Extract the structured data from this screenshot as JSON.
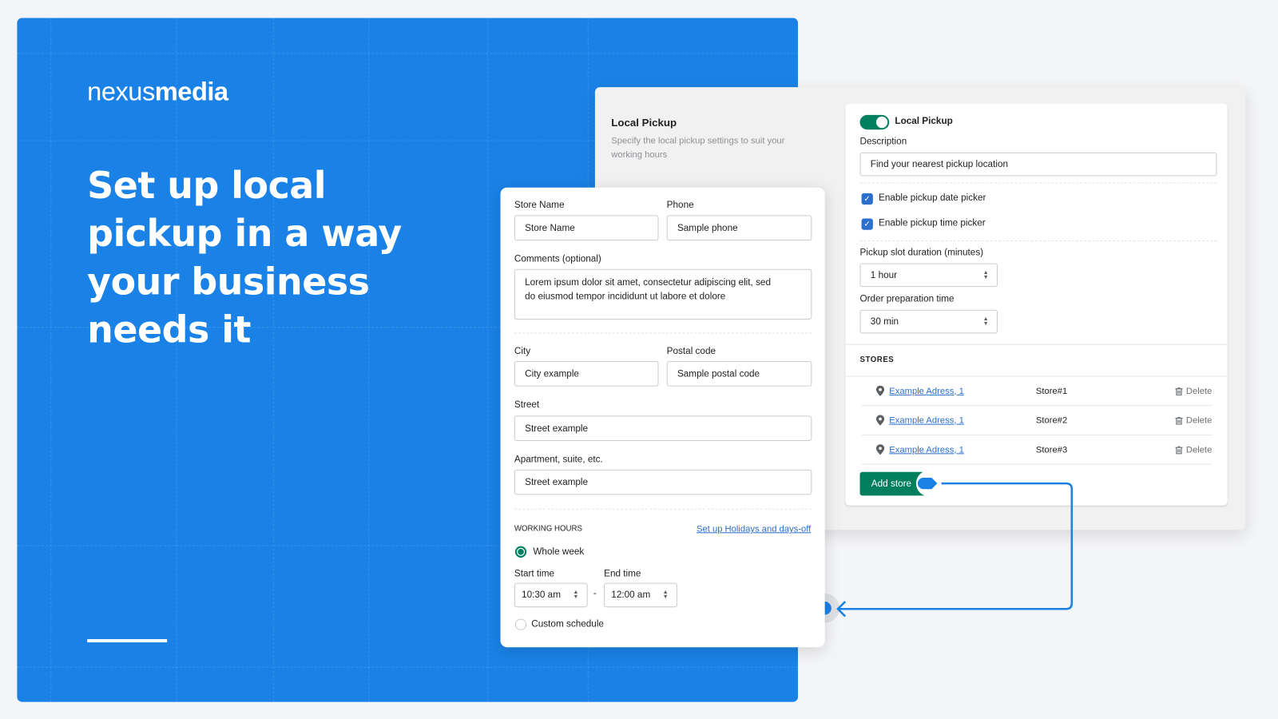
{
  "brand": {
    "logo_light": "nexus",
    "logo_bold": "media"
  },
  "hero": {
    "headline": "Set up local pickup in a way your business needs it"
  },
  "colors": {
    "hero_blue": "#1a82e6",
    "primary_green": "#008060",
    "link_blue": "#2c6ecb",
    "connector_blue": "#1a82e6"
  },
  "settings": {
    "title": "Local Pickup",
    "subtitle": "Specify the local pickup settings to suit your working hours",
    "toggle_label": "Local Pickup",
    "toggle_on": true,
    "description_label": "Description",
    "description_value": "Find your nearest pickup location",
    "date_picker_label": "Enable pickup date picker",
    "date_picker_checked": true,
    "time_picker_label": "Enable pickup time picker",
    "time_picker_checked": true,
    "slot_label": "Pickup slot duration (minutes)",
    "slot_value": "1 hour",
    "prep_label": "Order preparation time",
    "prep_value": "30 min",
    "stores_heading": "STORES",
    "stores": [
      {
        "address": "Example Adress, 1",
        "name": "Store#1",
        "delete": "Delete"
      },
      {
        "address": "Example Adress, 1",
        "name": "Store#2",
        "delete": "Delete"
      },
      {
        "address": "Example Adress, 1",
        "name": "Store#3",
        "delete": "Delete"
      }
    ],
    "add_store": "Add store"
  },
  "store_form": {
    "store_name_label": "Store Name",
    "store_name_value": "Store Name",
    "phone_label": "Phone",
    "phone_value": "Sample phone",
    "comments_label": "Comments (optional)",
    "comments_value": "Lorem ipsum dolor sit amet, consectetur adipiscing elit, sed do eiusmod tempor incididunt ut labore et dolore",
    "city_label": "City",
    "city_value": "City example",
    "postal_label": "Postal code",
    "postal_value": "Sample postal code",
    "street_label": "Street",
    "street_value": "Street example",
    "apt_label": "Apartment, suite, etc.",
    "apt_value": "Street example",
    "working_hours_heading": "WORKING HOURS",
    "holidays_link": "Set up Holidays and days-off",
    "whole_week_label": "Whole week",
    "start_label": "Start time",
    "start_value": "10:30 am",
    "separator": "-",
    "end_label": "End time",
    "end_value": "12:00 am",
    "custom_label": "Custom schedule",
    "selected_schedule": "Whole week"
  }
}
